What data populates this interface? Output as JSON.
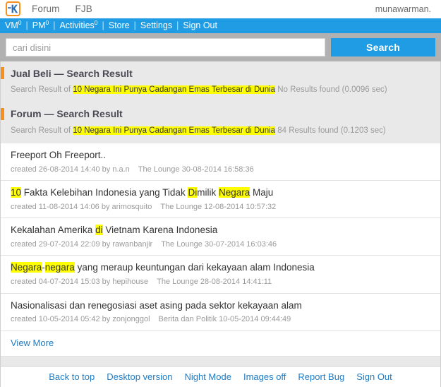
{
  "topbar": {
    "logo_icon": "kaskus-k-logo-icon",
    "nav": [
      {
        "label": "Forum"
      },
      {
        "label": "FJB"
      }
    ],
    "username": "munawarman."
  },
  "bluenav": {
    "items": [
      {
        "label": "VM",
        "badge": "0"
      },
      {
        "label": "PM",
        "badge": "0"
      },
      {
        "label": "Activities",
        "badge": "0"
      },
      {
        "label": "Store",
        "badge": ""
      },
      {
        "label": "Settings",
        "badge": ""
      },
      {
        "label": "Sign Out",
        "badge": ""
      }
    ],
    "separator": "|"
  },
  "search": {
    "placeholder": "cari disini",
    "value": "",
    "button_label": "Search"
  },
  "sections": [
    {
      "title": "Jual Beli — Search Result",
      "sub_prefix": "Search Result of ",
      "query": "10 Negara Ini Punya Cadangan Emas Terbesar di Dunia",
      "sub_suffix": " No Results found (0.0096 sec)"
    },
    {
      "title": "Forum — Search Result",
      "sub_prefix": "Search Result of ",
      "query": "10 Negara Ini Punya Cadangan Emas Terbesar di Dunia",
      "sub_suffix": " 84 Results found (0.1203 sec)"
    }
  ],
  "results": [
    {
      "title_parts": [
        {
          "text": "Freeport Oh Freeport..",
          "highlight": false
        }
      ],
      "created": "created 26-08-2014 14:40 by n.a.n",
      "forum": "The Lounge 30-08-2014 16:58:36"
    },
    {
      "title_parts": [
        {
          "text": "10",
          "highlight": true
        },
        {
          "text": " Fakta Kelebihan Indonesia yang Tidak ",
          "highlight": false
        },
        {
          "text": "Di",
          "highlight": true
        },
        {
          "text": "milik ",
          "highlight": false
        },
        {
          "text": "Negara",
          "highlight": true
        },
        {
          "text": " Maju",
          "highlight": false
        }
      ],
      "created": "created 11-08-2014 14:06 by arimosquito",
      "forum": "The Lounge 12-08-2014 10:57:32"
    },
    {
      "title_parts": [
        {
          "text": "Kekalahan Amerika ",
          "highlight": false
        },
        {
          "text": "di",
          "highlight": true
        },
        {
          "text": " Vietnam Karena Indonesia",
          "highlight": false
        }
      ],
      "created": "created 29-07-2014 22:09 by rawanbanjir",
      "forum": "The Lounge 30-07-2014 16:03:46"
    },
    {
      "title_parts": [
        {
          "text": "Negara",
          "highlight": true
        },
        {
          "text": "-",
          "highlight": false
        },
        {
          "text": "negara",
          "highlight": true
        },
        {
          "text": " yang meraup keuntungan dari kekayaan alam Indonesia",
          "highlight": false
        }
      ],
      "created": "created 04-07-2014 15:03 by hepihouse",
      "forum": "The Lounge 28-08-2014 14:41:11"
    },
    {
      "title_parts": [
        {
          "text": "Nasionalisasi dan renegosiasi aset asing pada sektor kekayaan alam",
          "highlight": false
        }
      ],
      "created": "created 10-05-2014 05:42 by zonjonggol",
      "forum": "Berita dan Politik 10-05-2014 09:44:49"
    }
  ],
  "view_more": "View More",
  "footer": {
    "links": [
      {
        "label": "Back to top"
      },
      {
        "label": "Desktop version"
      },
      {
        "label": "Night Mode"
      },
      {
        "label": "Images off"
      },
      {
        "label": "Report Bug"
      },
      {
        "label": "Sign Out"
      }
    ]
  },
  "colors": {
    "brand_blue": "#1f9ce4",
    "accent_orange": "#f5901d",
    "highlight_yellow": "#ffff00",
    "link_blue": "#1f7bc4",
    "panel_grey": "#e9e9e9",
    "searchbar_grey": "#b1b1b1"
  }
}
